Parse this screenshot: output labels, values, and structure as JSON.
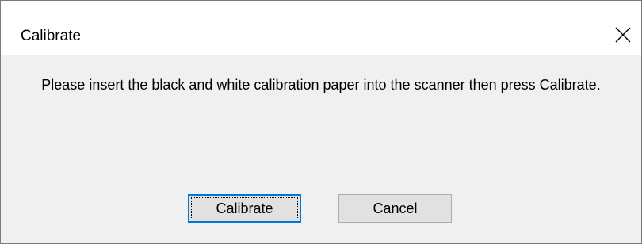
{
  "window": {
    "title": "Calibrate",
    "close_icon": "close-icon"
  },
  "dialog": {
    "message": "Please insert the black and white calibration paper into the scanner then press Calibrate."
  },
  "buttons": {
    "calibrate_label": "Calibrate",
    "cancel_label": "Cancel"
  },
  "colors": {
    "focus_border": "#0078d7",
    "button_face": "#e1e1e1",
    "dialog_background": "#f0f0f0"
  }
}
